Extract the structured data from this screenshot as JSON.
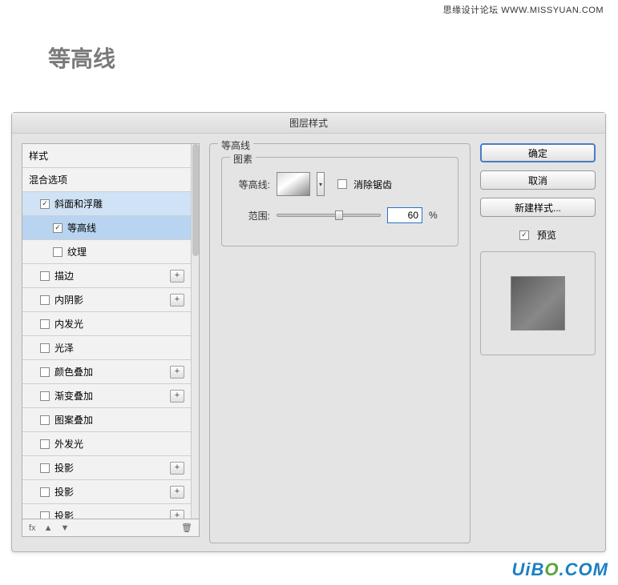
{
  "watermark_top": "思缘设计论坛  WWW.MISSYUAN.COM",
  "page_title": "等高线",
  "dialog_title": "图层样式",
  "styles": {
    "header": "样式",
    "blend": "混合选项",
    "items": [
      {
        "label": "斜面和浮雕",
        "checked": true,
        "indent": 1,
        "sel": "selected-light"
      },
      {
        "label": "等高线",
        "checked": true,
        "indent": 2,
        "sel": "selected"
      },
      {
        "label": "纹理",
        "checked": false,
        "indent": 2,
        "sel": ""
      },
      {
        "label": "描边",
        "checked": false,
        "indent": 1,
        "plus": true
      },
      {
        "label": "内阴影",
        "checked": false,
        "indent": 1,
        "plus": true
      },
      {
        "label": "内发光",
        "checked": false,
        "indent": 1
      },
      {
        "label": "光泽",
        "checked": false,
        "indent": 1
      },
      {
        "label": "颜色叠加",
        "checked": false,
        "indent": 1,
        "plus": true
      },
      {
        "label": "渐变叠加",
        "checked": false,
        "indent": 1,
        "plus": true
      },
      {
        "label": "图案叠加",
        "checked": false,
        "indent": 1
      },
      {
        "label": "外发光",
        "checked": false,
        "indent": 1
      },
      {
        "label": "投影",
        "checked": false,
        "indent": 1,
        "plus": true
      },
      {
        "label": "投影",
        "checked": false,
        "indent": 1,
        "plus": true
      },
      {
        "label": "投影",
        "checked": false,
        "indent": 1,
        "plus": true
      }
    ],
    "footer_fx": "fx"
  },
  "center": {
    "group_title": "等高线",
    "inner_title": "图素",
    "contour_label": "等高线:",
    "antialias_label": "消除锯齿",
    "range_label": "范围:",
    "range_value": "60",
    "pct": "%"
  },
  "buttons": {
    "ok": "确定",
    "cancel": "取消",
    "new_style": "新建样式...",
    "preview": "预览"
  },
  "watermark_bottom_a": "UiB",
  "watermark_bottom_b": "O",
  "watermark_bottom_c": ".COM"
}
